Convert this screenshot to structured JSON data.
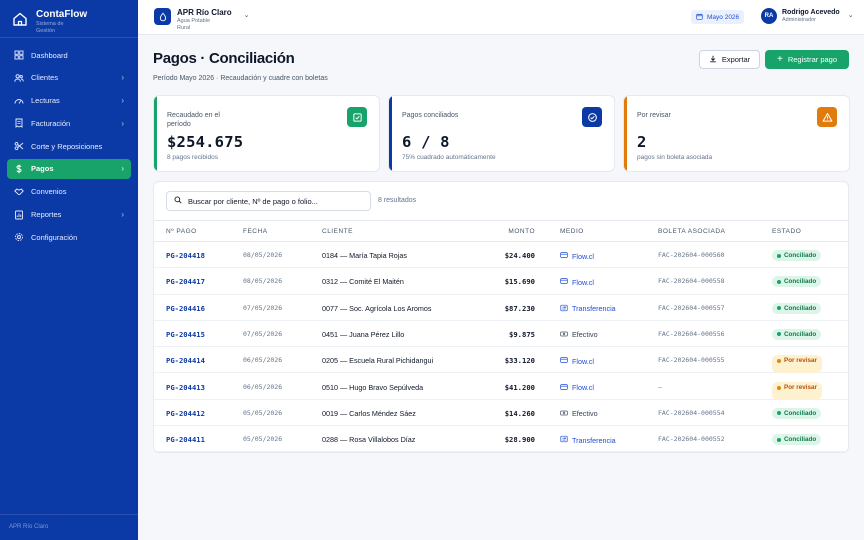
{
  "app": {
    "name": "ContaFlow",
    "subtitle": "Sistema de Gestión",
    "footer": "APR Río Claro"
  },
  "sidebar": {
    "items": [
      {
        "label": "Dashboard",
        "icon": "dashboard-icon",
        "has_children": false,
        "active": false
      },
      {
        "label": "Clientes",
        "icon": "users-icon",
        "has_children": true,
        "active": false
      },
      {
        "label": "Lecturas",
        "icon": "gauge-icon",
        "has_children": true,
        "active": false
      },
      {
        "label": "Facturación",
        "icon": "invoice-icon",
        "has_children": true,
        "active": false
      },
      {
        "label": "Corte y Reposiciones",
        "icon": "scissors-icon",
        "has_children": false,
        "active": false
      },
      {
        "label": "Pagos",
        "icon": "dollar-icon",
        "has_children": true,
        "active": true
      },
      {
        "label": "Convenios",
        "icon": "handshake-icon",
        "has_children": false,
        "active": false
      },
      {
        "label": "Reportes",
        "icon": "report-icon",
        "has_children": true,
        "active": false
      },
      {
        "label": "Configuración",
        "icon": "gear-icon",
        "has_children": false,
        "active": false
      }
    ]
  },
  "header": {
    "org_name": "APR Río Claro",
    "org_sub": "Agua Potable Rural",
    "period": "Mayo 2026",
    "user_initials": "RA",
    "user_name": "Rodrigo Acevedo",
    "user_role": "Administrador"
  },
  "page": {
    "title": "Pagos · Conciliación",
    "subtitle": "Período Mayo 2026 · Recaudación y cuadre con boletas",
    "export_label": "Exportar",
    "new_label": "Registrar pago"
  },
  "kpis": [
    {
      "label": "Recaudado en el período",
      "value": "$254.675",
      "hint": "8 pagos recibidos",
      "color": "#18a36a",
      "icon": "receipt-icon"
    },
    {
      "label": "Pagos conciliados",
      "value": "6 / 8",
      "hint": "75% cuadrado automáticamente",
      "color": "#0b3aa6",
      "icon": "check-circle-icon"
    },
    {
      "label": "Por revisar",
      "value": "2",
      "hint": "pagos sin boleta asociada",
      "color": "#e07c0c",
      "icon": "warning-icon"
    }
  ],
  "table": {
    "search_placeholder": "Buscar por cliente, Nº de pago o folio...",
    "result_count": "8 resultados",
    "columns": {
      "id": "Nº PAGO",
      "date": "FECHA",
      "client": "CLIENTE",
      "amount": "MONTO",
      "medio": "MEDIO",
      "boleta": "BOLETA ASOCIADA",
      "estado": "ESTADO"
    },
    "rows": [
      {
        "id": "PG-204418",
        "date": "08/05/2026",
        "client": "0184 — María Tapia Rojas",
        "amount": "$24.400",
        "medio": "Flow.cl",
        "medio_kind": "card",
        "boleta": "FAC-202604-000560",
        "estado": "Conciliado",
        "ok": true
      },
      {
        "id": "PG-204417",
        "date": "08/05/2026",
        "client": "0312 — Comité El Maitén",
        "amount": "$15.690",
        "medio": "Flow.cl",
        "medio_kind": "card",
        "boleta": "FAC-202604-000558",
        "estado": "Conciliado",
        "ok": true
      },
      {
        "id": "PG-204416",
        "date": "07/05/2026",
        "client": "0077 — Soc. Agrícola Los Aromos",
        "amount": "$87.230",
        "medio": "Transferencia",
        "medio_kind": "transfer",
        "boleta": "FAC-202604-000557",
        "estado": "Conciliado",
        "ok": true
      },
      {
        "id": "PG-204415",
        "date": "07/05/2026",
        "client": "0451 — Juana Pérez Lillo",
        "amount": "$9.875",
        "medio": "Efectivo",
        "medio_kind": "cash",
        "boleta": "FAC-202604-000556",
        "estado": "Conciliado",
        "ok": true
      },
      {
        "id": "PG-204414",
        "date": "06/05/2026",
        "client": "0205 — Escuela Rural Pichidangui",
        "amount": "$33.120",
        "medio": "Flow.cl",
        "medio_kind": "card",
        "boleta": "FAC-202604-000555",
        "estado": "Por revisar",
        "ok": false
      },
      {
        "id": "PG-204413",
        "date": "06/05/2026",
        "client": "0510 — Hugo Bravo Sepúlveda",
        "amount": "$41.200",
        "medio": "Flow.cl",
        "medio_kind": "card",
        "boleta": "—",
        "estado": "Por revisar",
        "ok": false
      },
      {
        "id": "PG-204412",
        "date": "05/05/2026",
        "client": "0019 — Carlos Méndez Sáez",
        "amount": "$14.260",
        "medio": "Efectivo",
        "medio_kind": "cash",
        "boleta": "FAC-202604-000554",
        "estado": "Conciliado",
        "ok": true
      },
      {
        "id": "PG-204411",
        "date": "05/05/2026",
        "client": "0288 — Rosa Villalobos Díaz",
        "amount": "$28.900",
        "medio": "Transferencia",
        "medio_kind": "transfer",
        "boleta": "FAC-202604-000552",
        "estado": "Conciliado",
        "ok": true
      }
    ]
  }
}
